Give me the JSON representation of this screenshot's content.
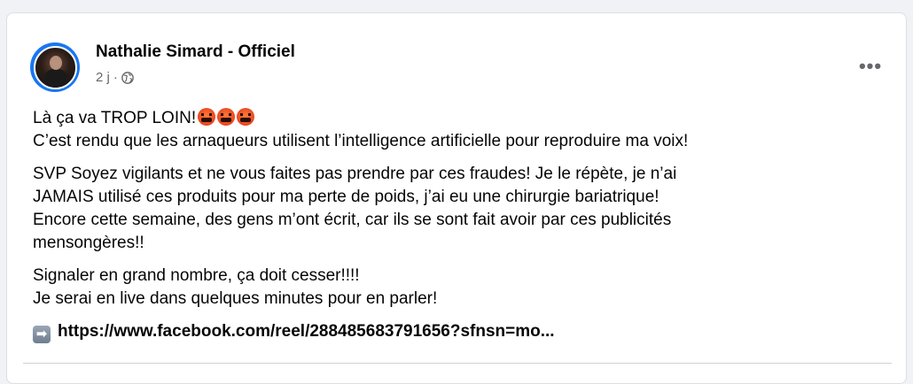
{
  "post": {
    "author": "Nathalie Simard - Officiel",
    "timestamp": "2 j",
    "separator": "·",
    "visibility_icon": "globe-icon",
    "more_icon": "more-options-icon",
    "more_glyph": "•••",
    "paragraphs": {
      "p1_line1": "Là ça va TROP LOIN!",
      "p1_emoji": "enraged-face-with-symbols",
      "p1_line2": "C’est rendu que les arnaqueurs utilisent l’intelligence artificielle pour reproduire ma voix!",
      "p2_line1": "SVP Soyez vigilants et ne vous faites pas prendre par ces fraudes! Je le répète, je n’ai",
      "p2_line2": "JAMAIS utilisé ces produits pour ma perte de poids, j’ai eu une chirurgie bariatrique!",
      "p2_line3": "Encore cette semaine, des gens m’ont écrit, car ils se sont fait avoir par ces publicités",
      "p2_line4": "mensongères!!",
      "p3_line1": "Signaler en grand nombre, ça doit cesser!!!!",
      "p3_line2": "Je serai en live dans quelques minutes pour en parler!",
      "arrow_glyph": "➡",
      "link_text": "https://www.facebook.com/reel/288485683791656?sfnsn=mo..."
    }
  },
  "colors": {
    "accent": "#1877f2",
    "secondary_text": "#65676b",
    "background": "#f0f2f5"
  }
}
